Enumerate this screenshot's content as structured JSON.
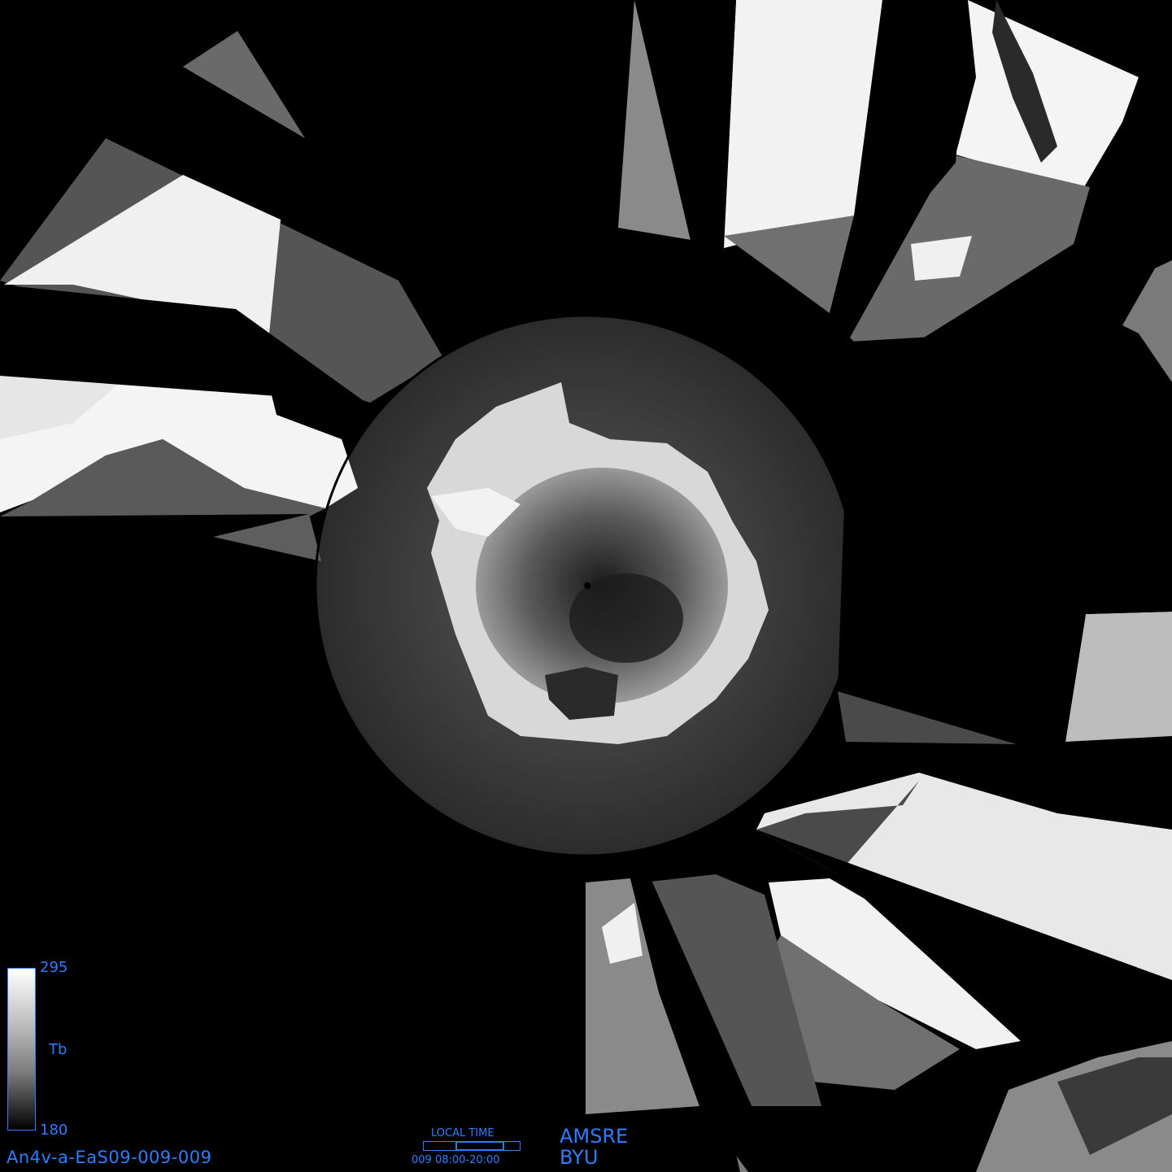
{
  "product_id": "An4v-a-EaS09-009-009",
  "colorbar": {
    "max_label": "295",
    "min_label": "180",
    "variable_label": "Tb",
    "colors": [
      "#ffffff",
      "#000000"
    ]
  },
  "local_time": {
    "title": "LOCAL TIME",
    "range_label": "009 08:00-20:00"
  },
  "credits": {
    "sensor": "AMSRE",
    "org": "BYU"
  },
  "theme": {
    "background": "#000000",
    "text_color": "#2f7dff",
    "ocean_tone": "#3a3a3a",
    "ice_tone": "#efefef"
  }
}
